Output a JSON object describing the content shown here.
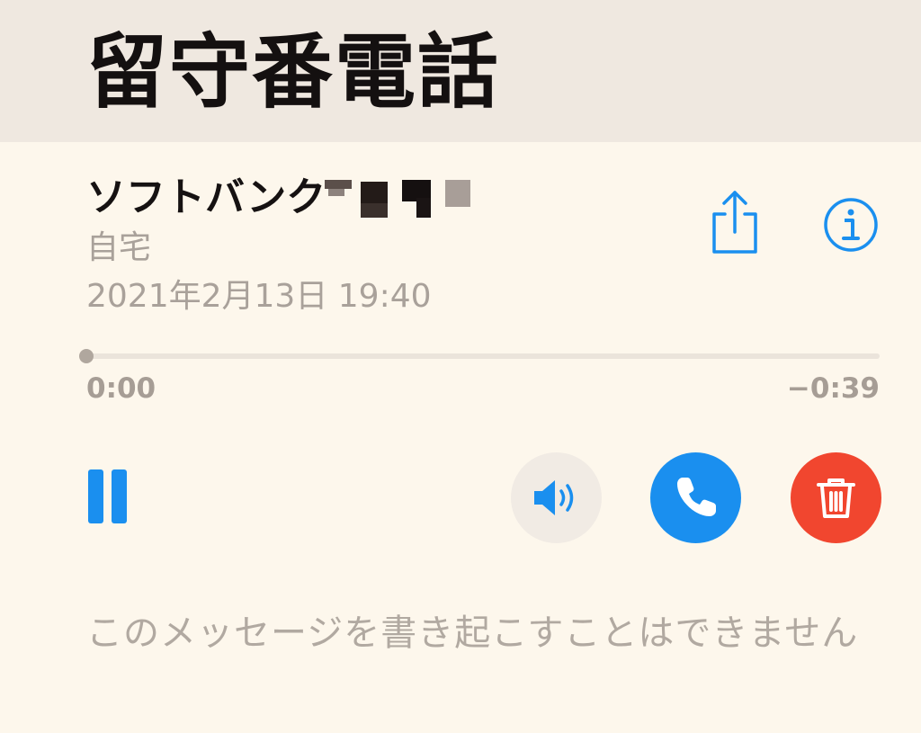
{
  "header": {
    "title": "留守番電話"
  },
  "voicemail": {
    "caller_name": "ソフトバンク",
    "caller_label": "自宅",
    "timestamp": "2021年2月13日 19:40"
  },
  "actions": {
    "share_icon": "share-icon",
    "info_icon": "info-circle-icon"
  },
  "playback": {
    "progress": 0.0,
    "elapsed": "0:00",
    "remaining": "−0:39"
  },
  "controls": {
    "pause_icon": "pause-icon",
    "speaker_icon": "speaker-icon",
    "call_icon": "phone-icon",
    "delete_icon": "trash-icon"
  },
  "colors": {
    "accent": "#1a8fef",
    "delete": "#f1462f"
  },
  "transcript": {
    "message": "このメッセージを書き起こすことはできません"
  }
}
